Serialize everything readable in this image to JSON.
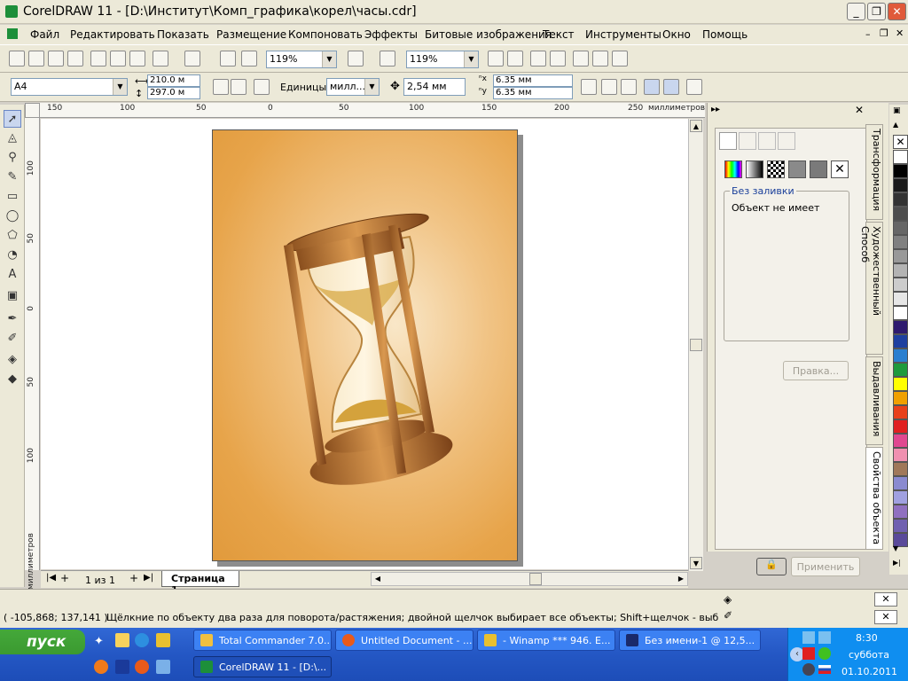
{
  "window": {
    "title": "CorelDRAW 11 - [D:\\Институт\\Комп_графика\\корел\\часы.cdr]",
    "buttons": [
      "_",
      "❐",
      "✕"
    ]
  },
  "menu": [
    "Файл",
    "Редактировать",
    "Показать",
    "Размещение",
    "Компоновать",
    "Эффекты",
    "Битовые изображения",
    "Текст",
    "Инструменты",
    "Окно",
    "Помощь"
  ],
  "toolbar": {
    "zoom1": "119%",
    "zoom2": "119%"
  },
  "propbar": {
    "paper_size": "A4",
    "width": "210.0 м",
    "height": "297.0 м",
    "units_label": "Единицы:",
    "units_value": "милл...",
    "nudge": "2,54 мм",
    "dup_x": "6.35 мм",
    "dup_y": "6.35 мм"
  },
  "ruler": {
    "h_labels": [
      "150",
      "100",
      "50",
      "0",
      "50",
      "100",
      "150",
      "200",
      "250"
    ],
    "h_unit": "миллиметров",
    "v_labels": [
      "100",
      "50",
      "0",
      "50",
      "100"
    ],
    "v_unit": "миллиметров"
  },
  "pagebar": {
    "counter": "1 из 1",
    "page_tab": "Страница 1"
  },
  "docker": {
    "group_label": "Без заливки",
    "message": "Объект не имеет",
    "edit_button": "Правка...",
    "apply_button": "Применить",
    "tabs": [
      "Трансформация",
      "Художественный Способ",
      "Выдавливания",
      "Свойства объекта"
    ]
  },
  "palette": [
    "#ffffff",
    "#000000",
    "#1a1a1a",
    "#333333",
    "#4d4d4d",
    "#666666",
    "#808080",
    "#999999",
    "#b3b3b3",
    "#cccccc",
    "#e6e6e6",
    "#ffffff",
    "#2e1a6e",
    "#1e40a0",
    "#2a7fd0",
    "#1e9a3c",
    "#ffff00",
    "#f0a000",
    "#e8401a",
    "#e02020",
    "#e04890",
    "#f090b0",
    "#a0785a",
    "#8a8ad0",
    "#a0a0e0",
    "#9070c0",
    "#7060b0",
    "#5a4a9a"
  ],
  "status": {
    "coords": "( -105,868; 137,141 )",
    "hint": "Щёлкние по объекту два раза для поворота/растяжения; двойной щелчок выбирает все объекты; Shift+щелчок - выбор нескольких; А..."
  },
  "taskbar": {
    "start": "пуск",
    "tasks": [
      "Total Commander 7.0...",
      "Untitled Document - ...",
      "- Winamp *** 946. E...",
      "Без имени-1 @ 12,5...",
      "CorelDRAW 11 - [D:\\..."
    ],
    "clock": "8:30",
    "day": "суббота",
    "date": "01.10.2011"
  },
  "colors": {
    "page_bg": "#e7a44a",
    "taskbar": "#2457c4",
    "start": "#3b9a30"
  }
}
